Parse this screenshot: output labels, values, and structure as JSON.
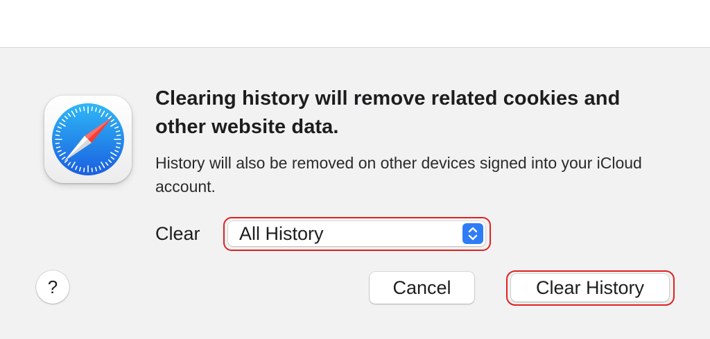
{
  "dialog": {
    "title": "Clearing history will remove related cookies and other website data.",
    "message": "History will also be removed on other devices signed into your iCloud account.",
    "clear_label": "Clear",
    "range_select": {
      "selected": "All History"
    },
    "help_label": "?",
    "cancel_label": "Cancel",
    "confirm_label": "Clear History"
  },
  "icons": {
    "app": "safari-compass-icon",
    "select_stepper": "chevron-up-down-icon"
  },
  "colors": {
    "accent": "#2f7df6",
    "highlight": "#e02020",
    "dialog_bg": "#f2f2f2"
  }
}
